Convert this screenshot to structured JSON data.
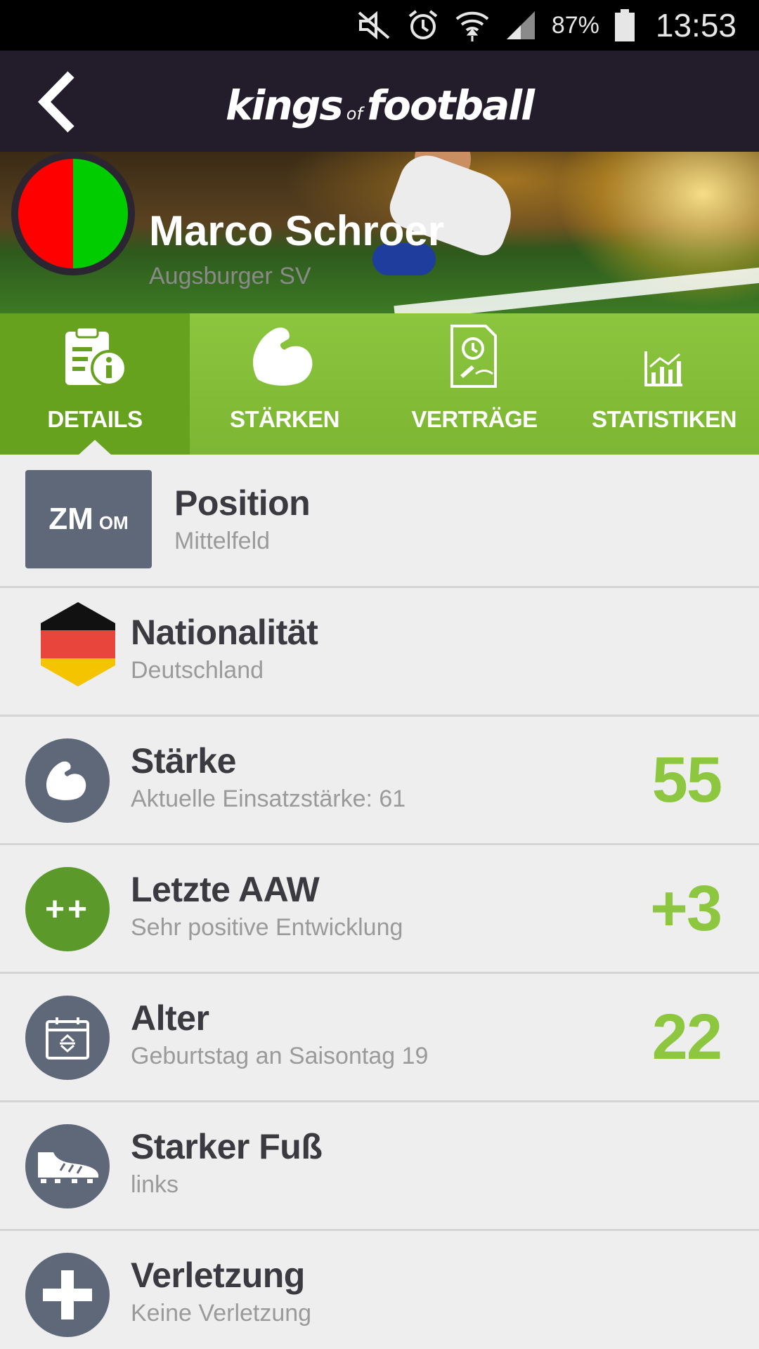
{
  "status_bar": {
    "battery_percent": "87%",
    "time": "13:53",
    "icons": [
      "mute-icon",
      "alarm-icon",
      "wifi-icon",
      "signal-icon",
      "battery-icon"
    ]
  },
  "app_bar": {
    "brand_part1": "kings",
    "brand_part2": "of",
    "brand_part3": "football",
    "back_icon": "back-arrow-icon"
  },
  "player": {
    "name": "Marco Schroer",
    "club": "Augsburger SV",
    "badge_colors": [
      "#ff0000",
      "#00cc00"
    ]
  },
  "tabs": [
    {
      "label": "DETAILS",
      "icon": "details-info-icon",
      "active": true
    },
    {
      "label": "STÄRKEN",
      "icon": "muscle-icon",
      "active": false
    },
    {
      "label": "VERTRÄGE",
      "icon": "contract-icon",
      "active": false
    },
    {
      "label": "STATISTIKEN",
      "icon": "statistics-icon",
      "active": false
    }
  ],
  "details": {
    "position": {
      "chip_main": "ZM",
      "chip_secondary": "OM",
      "title": "Position",
      "subtitle": "Mittelfeld"
    },
    "nationality": {
      "title": "Nationalität",
      "subtitle": "Deutschland",
      "flag_colors": [
        "#111111",
        "#e8453c",
        "#f5c400"
      ]
    },
    "strength": {
      "title": "Stärke",
      "subtitle": "Aktuelle Einsatzstärke: 61",
      "value": "55",
      "icon": "muscle-icon"
    },
    "last_aaw": {
      "badge": "++",
      "title": "Letzte AAW",
      "subtitle": "Sehr positive Entwicklung",
      "value": "+3"
    },
    "age": {
      "title": "Alter",
      "subtitle": "Geburtstag an Saisontag 19",
      "value": "22",
      "icon": "calendar-icon"
    },
    "strong_foot": {
      "title": "Starker Fuß",
      "subtitle": "links",
      "icon": "boot-icon"
    },
    "injury": {
      "title": "Verletzung",
      "subtitle": "Keine Verletzung",
      "icon": "medical-cross-icon"
    }
  },
  "colors": {
    "accent_green": "#8dc63f",
    "appbar_dark": "#231d2b",
    "icon_grey": "#5f6878"
  }
}
